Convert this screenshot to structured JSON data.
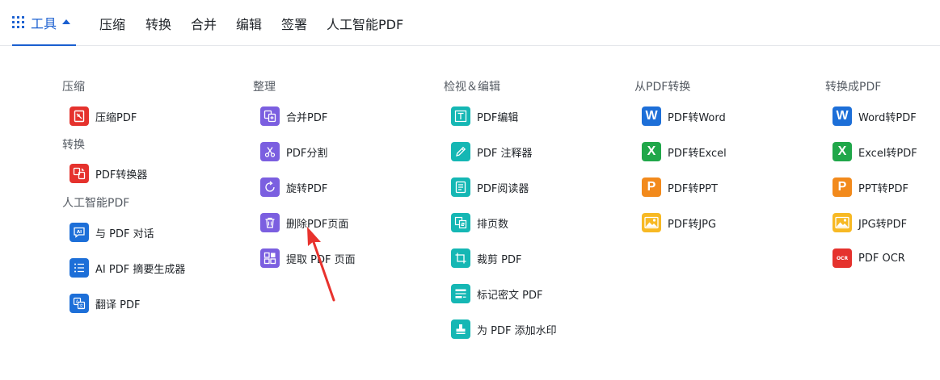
{
  "nav": {
    "tools": "工具",
    "links": [
      "压缩",
      "转换",
      "合并",
      "编辑",
      "签署",
      "人工智能PDF"
    ]
  },
  "col1": {
    "sections": [
      {
        "heading": "压缩",
        "items": [
          {
            "label": "压缩PDF",
            "icon": "compress-icon"
          }
        ]
      },
      {
        "heading": "转换",
        "items": [
          {
            "label": "PDF转换器",
            "icon": "convert-icon"
          }
        ]
      },
      {
        "heading": "人工智能PDF",
        "items": [
          {
            "label": "与 PDF 对话",
            "icon": "ai-chat-icon"
          },
          {
            "label": "AI PDF 摘要生成器",
            "icon": "list-summary-icon"
          },
          {
            "label": "翻译 PDF",
            "icon": "translate-icon"
          }
        ]
      }
    ]
  },
  "col2": {
    "heading": "整理",
    "items": [
      {
        "label": "合并PDF",
        "icon": "merge-icon"
      },
      {
        "label": "PDF分割",
        "icon": "scissors-icon"
      },
      {
        "label": "旋转PDF",
        "icon": "rotate-icon"
      },
      {
        "label": "删除PDF页面",
        "icon": "trash-icon"
      },
      {
        "label": "提取 PDF 页面",
        "icon": "extract-pages-icon"
      }
    ]
  },
  "col3": {
    "heading": "检视＆编辑",
    "items": [
      {
        "label": "PDF编辑",
        "icon": "text-edit-icon"
      },
      {
        "label": "PDF 注释器",
        "icon": "pencil-icon"
      },
      {
        "label": "PDF阅读器",
        "icon": "reader-icon"
      },
      {
        "label": "排页数",
        "icon": "page-numbers-icon"
      },
      {
        "label": "裁剪 PDF",
        "icon": "crop-icon"
      },
      {
        "label": "标记密文 PDF",
        "icon": "redact-icon"
      },
      {
        "label": "为 PDF 添加水印",
        "icon": "stamp-icon"
      }
    ]
  },
  "col4": {
    "heading": "从PDF转换",
    "items": [
      {
        "label": "PDF转Word",
        "icon": "word-icon",
        "letter": "W"
      },
      {
        "label": "PDF转Excel",
        "icon": "excel-icon",
        "letter": "X"
      },
      {
        "label": "PDF转PPT",
        "icon": "ppt-icon",
        "letter": "P"
      },
      {
        "label": "PDF转JPG",
        "icon": "image-icon"
      }
    ]
  },
  "col5": {
    "heading": "转换成PDF",
    "items": [
      {
        "label": "Word转PDF",
        "icon": "word-icon",
        "letter": "W"
      },
      {
        "label": "Excel转PDF",
        "icon": "excel-icon",
        "letter": "X"
      },
      {
        "label": "PPT转PDF",
        "icon": "ppt-icon",
        "letter": "P"
      },
      {
        "label": "JPG转PDF",
        "icon": "image-icon"
      },
      {
        "label": "PDF OCR",
        "icon": "ocr-icon",
        "badge": "OCR"
      }
    ]
  },
  "colors": {
    "accent": "#1a5fd0",
    "red": "#e5322d",
    "purple": "#7b5fe0",
    "teal": "#15b7b4",
    "word_blue": "#1d6fd8",
    "excel_green": "#20a74a",
    "ppt_orange": "#f28a1c",
    "jpg_yellow": "#f7b924",
    "annotation_arrow": "#e8322d"
  }
}
